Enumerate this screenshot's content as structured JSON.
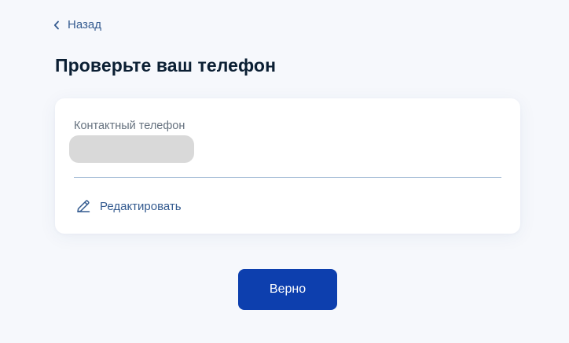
{
  "nav": {
    "back_label": "Назад",
    "back_icon": "chevron-left-icon"
  },
  "page": {
    "title": "Проверьте ваш телефон"
  },
  "contact_card": {
    "field_label": "Контактный телефон",
    "phone_value": "",
    "edit_label": "Редактировать",
    "edit_icon": "pencil-icon"
  },
  "actions": {
    "confirm_label": "Верно"
  },
  "colors": {
    "background": "#f6f8fc",
    "card": "#ffffff",
    "primary_button": "#0d3fae",
    "link": "#335a8f",
    "title": "#0b1f33",
    "muted_label": "#66727f",
    "divider": "#a3bbd6",
    "redaction": "#d9d9d9"
  }
}
